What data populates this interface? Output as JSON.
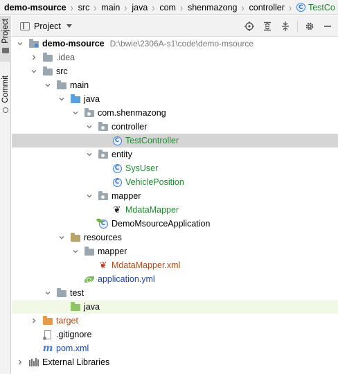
{
  "breadcrumbs": [
    {
      "label": "demo-msource",
      "icon": "module-folder-icon"
    },
    {
      "label": "src",
      "icon": null
    },
    {
      "label": "main",
      "icon": null
    },
    {
      "label": "java",
      "icon": null
    },
    {
      "label": "com",
      "icon": null
    },
    {
      "label": "shenmazong",
      "icon": null
    },
    {
      "label": "controller",
      "icon": null
    },
    {
      "label": "TestCo",
      "icon": "class-icon"
    }
  ],
  "tool_strip": {
    "project_tab": "Project",
    "commit_tab": "Commit"
  },
  "panel": {
    "title": "Project",
    "tools": [
      "locate-icon",
      "expand-all-icon",
      "collapse-all-icon",
      "gear-icon",
      "hide-icon"
    ]
  },
  "tree": [
    {
      "label": "demo-msource",
      "path": "D:\\bwie\\2306A-s1\\code\\demo-msource",
      "depth": 0,
      "arrow": "down",
      "icon": "module-folder",
      "style": "bold"
    },
    {
      "label": ".idea",
      "depth": 1,
      "arrow": "right",
      "icon": "folder-gray",
      "style": "gray"
    },
    {
      "label": "src",
      "depth": 1,
      "arrow": "down",
      "icon": "folder-gray",
      "style": ""
    },
    {
      "label": "main",
      "depth": 2,
      "arrow": "down",
      "icon": "folder-gray",
      "style": ""
    },
    {
      "label": "java",
      "depth": 3,
      "arrow": "down",
      "icon": "folder-blue",
      "style": ""
    },
    {
      "label": "com.shenmazong",
      "depth": 4,
      "arrow": "down",
      "icon": "package",
      "style": ""
    },
    {
      "label": "controller",
      "depth": 5,
      "arrow": "down",
      "icon": "package",
      "style": ""
    },
    {
      "label": "TestController",
      "depth": 6,
      "arrow": null,
      "icon": "class",
      "style": "green",
      "selected": true
    },
    {
      "label": "entity",
      "depth": 5,
      "arrow": "down",
      "icon": "package",
      "style": ""
    },
    {
      "label": "SysUser",
      "depth": 6,
      "arrow": null,
      "icon": "class",
      "style": "green"
    },
    {
      "label": "VehiclePosition",
      "depth": 6,
      "arrow": null,
      "icon": "class",
      "style": "green"
    },
    {
      "label": "mapper",
      "depth": 5,
      "arrow": "down",
      "icon": "package",
      "style": ""
    },
    {
      "label": "MdataMapper",
      "depth": 6,
      "arrow": null,
      "icon": "mybatis",
      "style": "green"
    },
    {
      "label": "DemoMsourceApplication",
      "depth": 5,
      "arrow": null,
      "icon": "spring-class",
      "style": ""
    },
    {
      "label": "resources",
      "depth": 3,
      "arrow": "down",
      "icon": "folder-res",
      "style": ""
    },
    {
      "label": "mapper",
      "depth": 4,
      "arrow": "down",
      "icon": "folder-gray",
      "style": ""
    },
    {
      "label": "MdataMapper.xml",
      "depth": 5,
      "arrow": null,
      "icon": "mybatis-red",
      "style": "brown"
    },
    {
      "label": "application.yml",
      "depth": 4,
      "arrow": null,
      "icon": "spring-leaf",
      "style": "blue"
    },
    {
      "label": "test",
      "depth": 2,
      "arrow": "down",
      "icon": "folder-gray",
      "style": ""
    },
    {
      "label": "java",
      "depth": 3,
      "arrow": null,
      "icon": "folder-test",
      "style": "",
      "highlight": true
    },
    {
      "label": "target",
      "depth": 1,
      "arrow": "right",
      "icon": "folder-orange",
      "style": "brown"
    },
    {
      "label": ".gitignore",
      "depth": 1,
      "arrow": null,
      "icon": "file",
      "style": ""
    },
    {
      "label": "pom.xml",
      "depth": 1,
      "arrow": null,
      "icon": "maven",
      "style": "blue"
    },
    {
      "label": "External Libraries",
      "depth": 0,
      "arrow": "right",
      "icon": "libraries",
      "style": ""
    }
  ],
  "colors": {
    "selection": "#d5d5d5",
    "highlight": "#f1f8e6",
    "class_green": "#1f8a2f",
    "link_blue": "#2244aa",
    "excluded_brown": "#b04a18"
  }
}
